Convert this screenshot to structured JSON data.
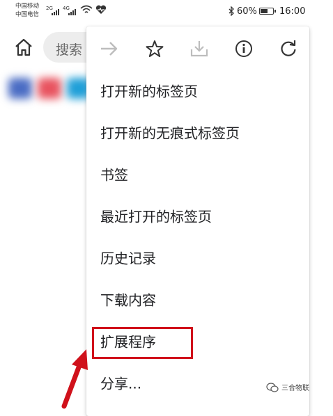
{
  "status_bar": {
    "carrier1": "中国移动",
    "carrier2": "中国电信",
    "net1": "2G",
    "net2": "4G",
    "battery_text": "60%",
    "battery_level": 0.6,
    "time": "16:00"
  },
  "toolbar": {
    "search_placeholder": "搜索"
  },
  "menu": {
    "icons": [
      "forward-icon",
      "star-icon",
      "download-icon",
      "info-icon",
      "refresh-icon"
    ],
    "items": [
      "打开新的标签页",
      "打开新的无痕式标签页",
      "书签",
      "最近打开的标签页",
      "历史记录",
      "下载内容",
      "扩展程序",
      "分享..."
    ],
    "highlighted_item": "扩展程序"
  },
  "annotation": {
    "highlight_color": "#d0111b"
  },
  "watermark": {
    "text": "三合物联"
  }
}
